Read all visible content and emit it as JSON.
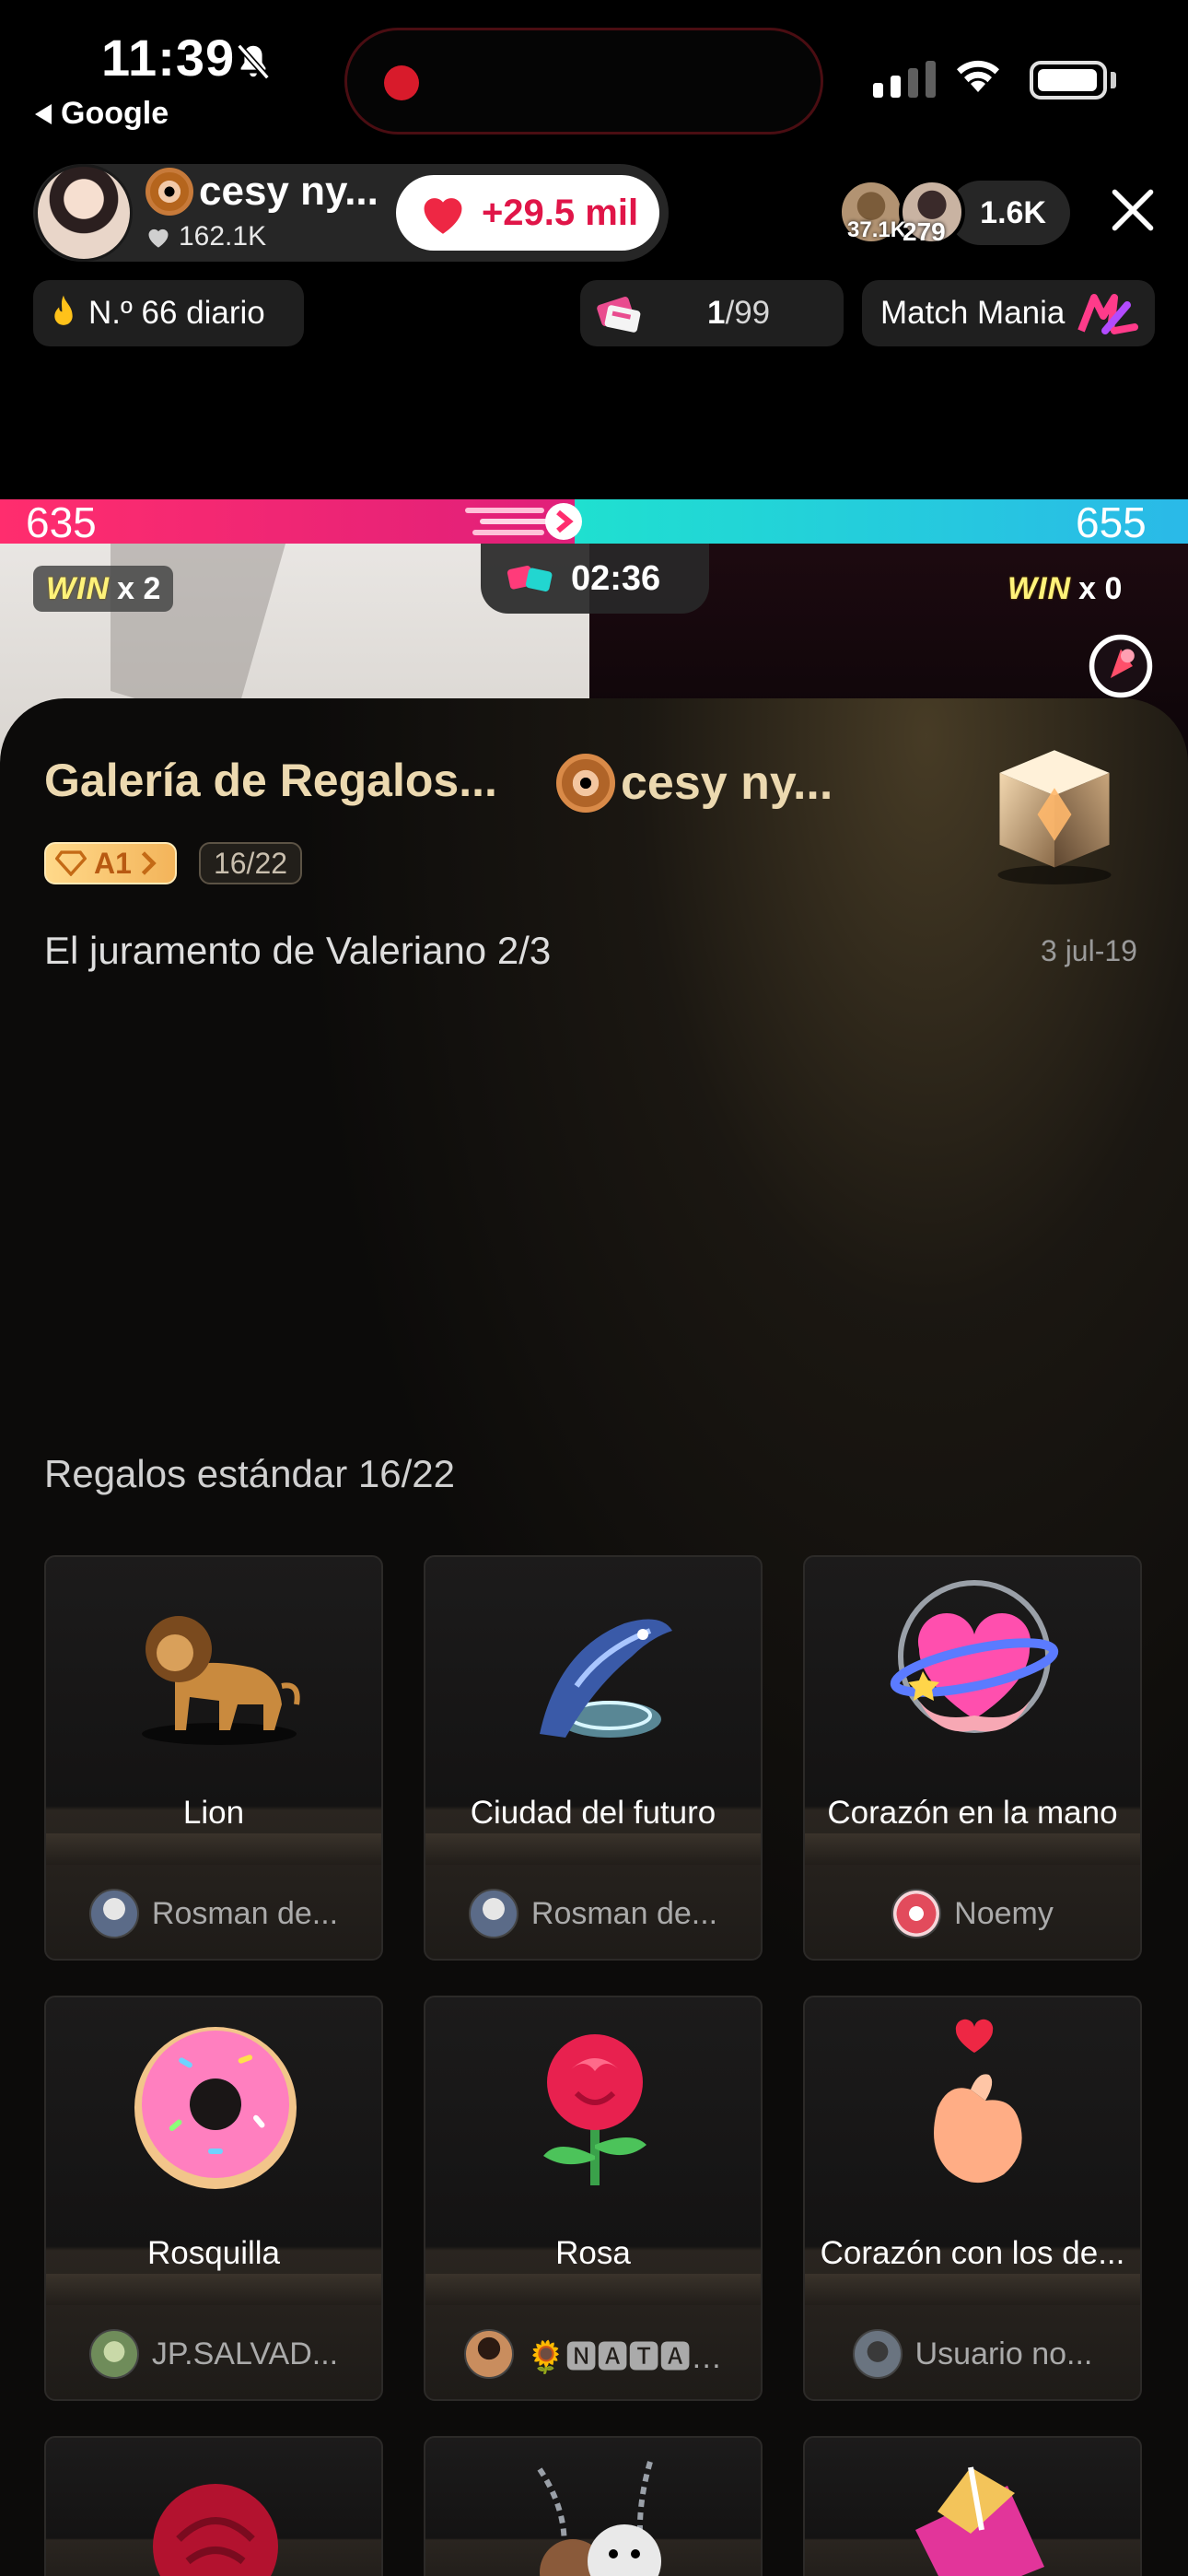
{
  "status_bar": {
    "time": "11:39",
    "back_app": "Google"
  },
  "host": {
    "name": "cesy ny...",
    "likes": "162.1K",
    "gift_total": "+29.5 mil"
  },
  "viewers": {
    "badge1": "37.1K",
    "badge2": "279",
    "total": "1.6K"
  },
  "pills": {
    "daily_rank": "N.º 66 diario",
    "ticket_current": "1",
    "ticket_total": "/99",
    "match_mania": "Match Mania"
  },
  "battle": {
    "score_left": "635",
    "score_right": "655",
    "win_word": "WIN",
    "win_left": "x 2",
    "win_right": "x 0",
    "timer": "02:36"
  },
  "gallery": {
    "title": "Galería de Regalos...",
    "host_name": "cesy ny...",
    "level": "A1",
    "progress": "16/22",
    "subtitle": "El juramento de Valeriano 2/3",
    "date": "3 jul-19",
    "section_title": "Regalos estándar 16/22"
  },
  "gifts": [
    {
      "name": "Lion",
      "user": "Rosman de...",
      "icon": "lion-icon"
    },
    {
      "name": "Ciudad del futuro",
      "user": "Rosman de...",
      "icon": "future-city-icon"
    },
    {
      "name": "Corazón en la mano",
      "user": "Noemy",
      "icon": "heart-in-hand-icon"
    },
    {
      "name": "Rosquilla",
      "user": "JP.SALVAD...",
      "icon": "donut-icon"
    },
    {
      "name": "Rosa",
      "user": "🌻🅽🅰🆃🅰…",
      "icon": "rose-icon"
    },
    {
      "name": "Corazón con los de...",
      "user": "Usuario no...",
      "icon": "finger-heart-icon"
    }
  ],
  "colors": {
    "accent_gold": "#ecd9b0",
    "battle_pink": "#ff2d6e",
    "battle_cyan": "#1fe0d0",
    "gift_red": "#e01548"
  }
}
